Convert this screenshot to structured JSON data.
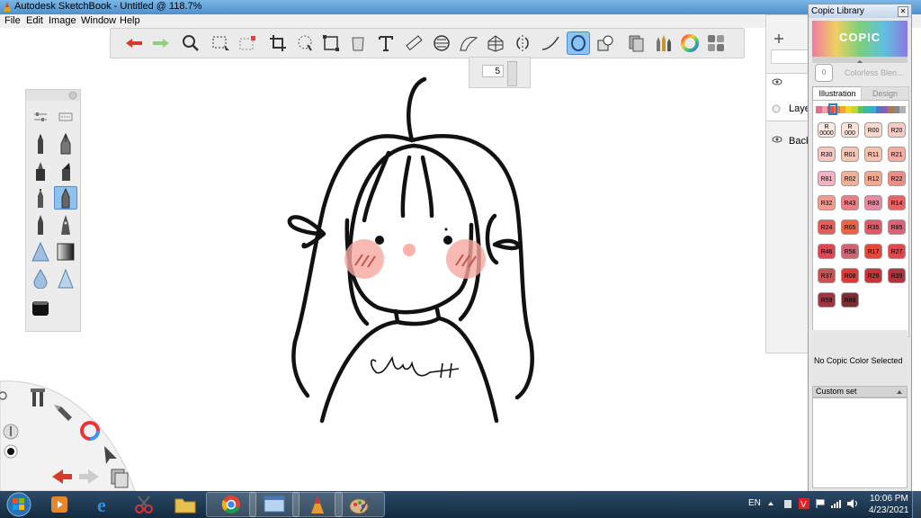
{
  "window": {
    "title": "Autodesk SketchBook - Untitled @ 118.7%"
  },
  "menu": [
    "File",
    "Edit",
    "Image",
    "Window",
    "Help"
  ],
  "toolbar": {
    "tools": [
      "undo-icon",
      "redo-icon",
      "zoom-icon",
      "select-icon",
      "select-marquee-icon",
      "crop-icon",
      "lasso-icon",
      "transform-icon",
      "fill-icon",
      "text-icon",
      "ruler-icon",
      "ellipse-guide-icon",
      "french-curve-icon",
      "perspective-icon",
      "symmetry-icon",
      "stroke-icon",
      "ellipse-icon",
      "shape-icon",
      "copic-icon",
      "brush-library-icon",
      "color-wheel-icon",
      "layers-icon"
    ],
    "active_tool": "ellipse-icon"
  },
  "brush_size": {
    "value": "5"
  },
  "layers": {
    "items": [
      "Laye",
      "Back"
    ]
  },
  "copic": {
    "title": "Copic Library",
    "logo": "COPIC",
    "colorless_label": "Colorless Blen...",
    "colorless_code": "0",
    "tabs": [
      "Illustration",
      "Design"
    ],
    "active_tab": "Illustration",
    "hue_strip": [
      "#e86b8e",
      "#f0a0b0",
      "#f04848",
      "#f07830",
      "#f0a830",
      "#f0d830",
      "#b8d840",
      "#60c060",
      "#40b8a0",
      "#40a8d8",
      "#4878c8",
      "#8860b8",
      "#b07848",
      "#888888",
      "#b0b0b0"
    ],
    "swatches": [
      {
        "code": "R 0000",
        "color": "#fde9e3"
      },
      {
        "code": "R 000",
        "color": "#fce3da"
      },
      {
        "code": "R00",
        "color": "#fbd8cc"
      },
      {
        "code": "R20",
        "color": "#f8cbc4"
      },
      {
        "code": "R30",
        "color": "#f6c7c0"
      },
      {
        "code": "R01",
        "color": "#f5c4b4"
      },
      {
        "code": "R11",
        "color": "#f7c2ae"
      },
      {
        "code": "R21",
        "color": "#f4aca4"
      },
      {
        "code": "R81",
        "color": "#f3b3c3"
      },
      {
        "code": "R02",
        "color": "#f4b19a"
      },
      {
        "code": "R12",
        "color": "#f5a890"
      },
      {
        "code": "R22",
        "color": "#ef8c84"
      },
      {
        "code": "R32",
        "color": "#f49c8e"
      },
      {
        "code": "R43",
        "color": "#ee7c82"
      },
      {
        "code": "R83",
        "color": "#e98aa0"
      },
      {
        "code": "R14",
        "color": "#ec6262"
      },
      {
        "code": "R24",
        "color": "#e95a5a"
      },
      {
        "code": "R05",
        "color": "#ec6444"
      },
      {
        "code": "R35",
        "color": "#e9566a"
      },
      {
        "code": "R85",
        "color": "#d86478"
      },
      {
        "code": "R46",
        "color": "#dd4652"
      },
      {
        "code": "R56",
        "color": "#d06472"
      },
      {
        "code": "R17",
        "color": "#e44838"
      },
      {
        "code": "R27",
        "color": "#e0484c"
      },
      {
        "code": "R37",
        "color": "#ce5054"
      },
      {
        "code": "R08",
        "color": "#dc3a34"
      },
      {
        "code": "R29",
        "color": "#d22e38"
      },
      {
        "code": "R39",
        "color": "#bb2c3c"
      },
      {
        "code": "R59",
        "color": "#9c3640"
      },
      {
        "code": "R89",
        "color": "#7c2e36"
      }
    ],
    "status": "No Copic Color Selected",
    "custom_set": "Custom set"
  },
  "taskbar": {
    "apps": [
      "explorer-media-icon",
      "internet-explorer-icon",
      "snipping-tool-icon",
      "file-explorer-icon",
      "chrome-icon",
      "window-manager-icon",
      "sketchbook-icon",
      "paint-icon"
    ],
    "language": "EN",
    "time": "10:06 PM",
    "date": "4/23/2021"
  },
  "drawing": {
    "signature": "Jean"
  }
}
